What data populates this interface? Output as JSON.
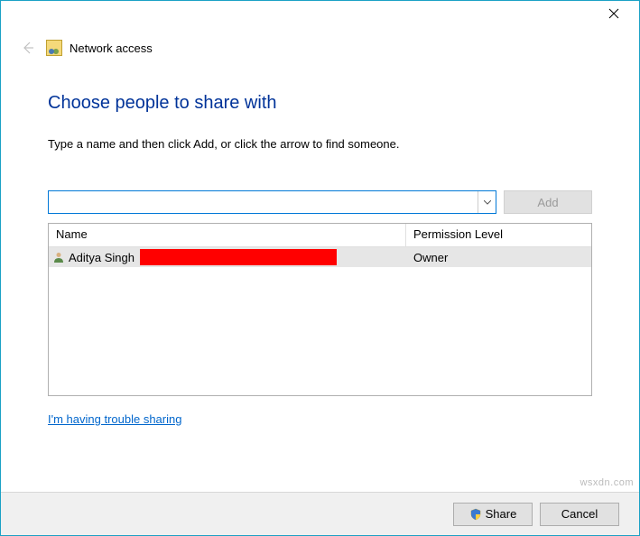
{
  "window": {
    "title": "Network access"
  },
  "main": {
    "heading": "Choose people to share with",
    "instruction": "Type a name and then click Add, or click the arrow to find someone.",
    "add_button": "Add",
    "input_value": ""
  },
  "table": {
    "headers": {
      "name": "Name",
      "permission": "Permission Level"
    },
    "rows": [
      {
        "name": "Aditya Singh",
        "permission": "Owner"
      }
    ]
  },
  "help_link": "I'm having trouble sharing",
  "footer": {
    "share": "Share",
    "cancel": "Cancel"
  },
  "watermark": "wsxdn.com"
}
